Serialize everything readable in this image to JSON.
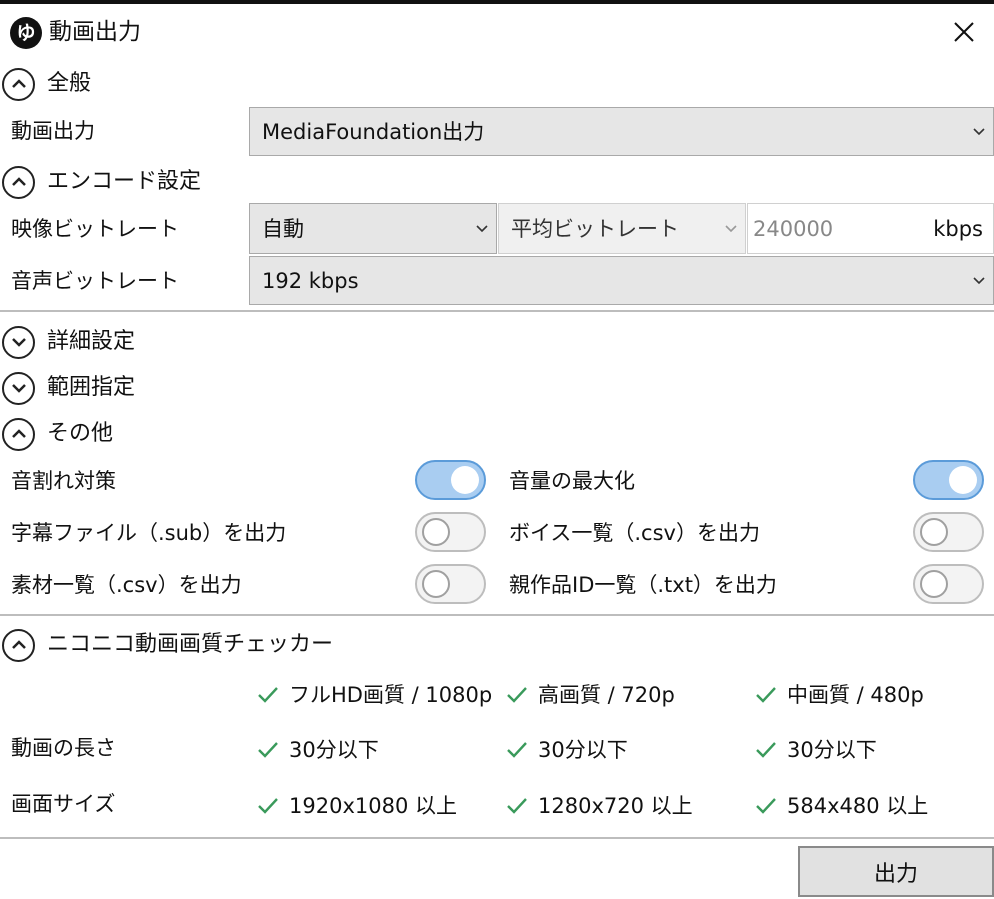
{
  "window": {
    "logo_text": "ゆ",
    "title": "動画出力"
  },
  "sections": {
    "general": "全般",
    "encode": "エンコード設定",
    "advanced": "詳細設定",
    "range": "範囲指定",
    "other": "その他",
    "checker": "ニコニコ動画画質チェッカー"
  },
  "general": {
    "label": "動画出力",
    "value": "MediaFoundation出力"
  },
  "encode": {
    "video_label": "映像ビットレート",
    "video_mode": "自動",
    "video_type": "平均ビットレート",
    "video_value": "240000",
    "video_unit": "kbps",
    "audio_label": "音声ビットレート",
    "audio_value": "192 kbps"
  },
  "other": {
    "items": [
      {
        "label": "音割れ対策",
        "on": true
      },
      {
        "label": "音量の最大化",
        "on": true
      },
      {
        "label": "字幕ファイル（.sub）を出力",
        "on": false
      },
      {
        "label": "ボイス一覧（.csv）を出力",
        "on": false
      },
      {
        "label": "素材一覧（.csv）を出力",
        "on": false
      },
      {
        "label": "親作品ID一覧（.txt）を出力",
        "on": false
      }
    ]
  },
  "checker": {
    "headers": [
      "フルHD画質 / 1080p",
      "高画質 / 720p",
      "中画質 / 480p"
    ],
    "rows": [
      {
        "label": "動画の長さ",
        "values": [
          "30分以下",
          "30分以下",
          "30分以下"
        ]
      },
      {
        "label": "画面サイズ",
        "values": [
          "1920x1080 以上",
          "1280x720 以上",
          "584x480 以上"
        ]
      }
    ]
  },
  "footer": {
    "output_button": "出力"
  },
  "colors": {
    "check": "#3a9a5b",
    "toggle_on": "#a9cdf1",
    "toggle_on_border": "#5b9bd9"
  }
}
